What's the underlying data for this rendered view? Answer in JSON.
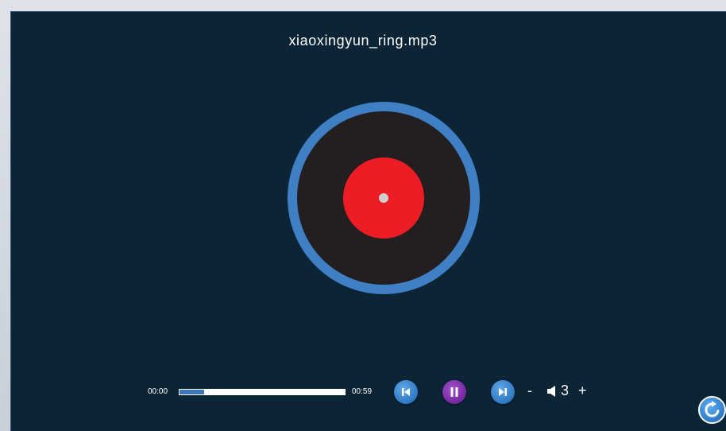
{
  "track": {
    "title": "xiaoxingyun_ring.mp3"
  },
  "playback": {
    "current_time": "00:00",
    "total_time": "00:59",
    "progress": 0.15,
    "state": "playing"
  },
  "volume": {
    "minus_label": "-",
    "level": "3",
    "plus_label": "+"
  },
  "icons": {
    "prev": "skip-previous-icon",
    "pause": "pause-icon",
    "next": "skip-next-icon",
    "volume": "speaker-icon",
    "corner": "refresh-icon"
  },
  "colors": {
    "background": "#0b2436",
    "disc_ring": "#3f7fc3",
    "disc": "#231f21",
    "label": "#ee1c24",
    "prev_next_button": "#2f78c4",
    "pause_button": "#74289e",
    "progress_fill": "#3a76b8"
  }
}
